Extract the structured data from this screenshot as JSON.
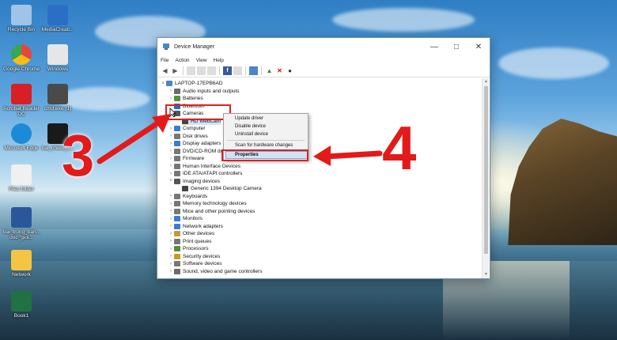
{
  "desktop": {
    "icons": [
      {
        "label": "Recycle Bin",
        "icon": "recycle-bin-icon",
        "color": "#9fc4e8"
      },
      {
        "label": "MediaCreati...",
        "icon": "media-creation-icon",
        "color": "#2b6fc4"
      },
      {
        "label": "Google Chrome",
        "icon": "chrome-icon",
        "color": "#e8453c"
      },
      {
        "label": "Windows",
        "icon": "file-icon",
        "color": "#e6e6e6"
      },
      {
        "label": "Acrobat Reader DC",
        "icon": "acrobat-icon",
        "color": "#d81f26"
      },
      {
        "label": "cmd.exe (1)",
        "icon": "usb-icon",
        "color": "#4a4a4a"
      },
      {
        "label": "Microsoft Edge",
        "icon": "edge-icon",
        "color": "#1b8bd6"
      },
      {
        "label": "bai_nhieu_3...",
        "icon": "video-icon",
        "color": "#1a1a1a"
      },
      {
        "label": "Files folder",
        "icon": "pdf-file-icon",
        "color": "#f0f0f0"
      },
      {
        "label": "bai_trong_ban... doc_gioi...",
        "icon": "word-icon",
        "color": "#2b579a"
      },
      {
        "label": "Network",
        "icon": "folder-icon",
        "color": "#f4c542"
      },
      {
        "label": "Book1",
        "icon": "excel-icon",
        "color": "#1f7244"
      }
    ]
  },
  "window": {
    "title": "Device Manager",
    "menu": [
      "File",
      "Action",
      "View",
      "Help"
    ],
    "root": "LAPTOP-17EPB6AD",
    "items": [
      {
        "label": "Audio inputs and outputs",
        "icon_color": "#6b6b6b"
      },
      {
        "label": "Batteries",
        "icon_color": "#5a8f3a"
      },
      {
        "label": "Bluetooth",
        "icon_color": "#1a6fd0"
      },
      {
        "label": "Cameras",
        "icon_color": "#555555",
        "expanded": true
      },
      {
        "label": "HD WebCam",
        "icon_color": "#444444",
        "child": true,
        "selected": true
      },
      {
        "label": "Computer",
        "icon_color": "#3a7bd5"
      },
      {
        "label": "Disk drives",
        "icon_color": "#777777"
      },
      {
        "label": "Display adapters",
        "icon_color": "#3a7bd5"
      },
      {
        "label": "DVD/CD-ROM drives",
        "icon_color": "#777777"
      },
      {
        "label": "Firmware",
        "icon_color": "#777777"
      },
      {
        "label": "Human Interface Devices",
        "icon_color": "#777777"
      },
      {
        "label": "IDE ATA/ATAPI controllers",
        "icon_color": "#777777"
      },
      {
        "label": "Imaging devices",
        "icon_color": "#555555",
        "expanded": true
      },
      {
        "label": "Generic 1394 Desktop Camera",
        "icon_color": "#444444",
        "child": true
      },
      {
        "label": "Keyboards",
        "icon_color": "#777777"
      },
      {
        "label": "Memory technology devices",
        "icon_color": "#777777"
      },
      {
        "label": "Mice and other pointing devices",
        "icon_color": "#777777"
      },
      {
        "label": "Monitors",
        "icon_color": "#3a7bd5"
      },
      {
        "label": "Network adapters",
        "icon_color": "#3a7bd5"
      },
      {
        "label": "Other devices",
        "icon_color": "#c79a2a"
      },
      {
        "label": "Print queues",
        "icon_color": "#777777"
      },
      {
        "label": "Processors",
        "icon_color": "#5a8f3a"
      },
      {
        "label": "Security devices",
        "icon_color": "#c79a2a"
      },
      {
        "label": "Software devices",
        "icon_color": "#777777"
      },
      {
        "label": "Sound, video and game controllers",
        "icon_color": "#6b6b6b"
      }
    ]
  },
  "context_menu": {
    "items": [
      "Update driver",
      "Disable device",
      "Uninstall device",
      "Scan for hardware changes",
      "Properties"
    ]
  },
  "annotations": {
    "step_a": "3",
    "step_b": "4",
    "color": "#e31a1a"
  }
}
